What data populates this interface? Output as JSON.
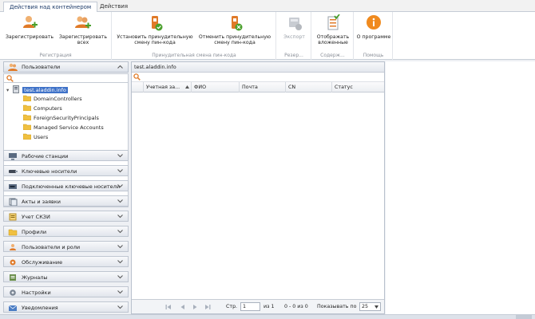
{
  "ribbon": {
    "tabs": [
      {
        "label": "Действия над контейнером",
        "active": true
      },
      {
        "label": "Действия",
        "active": false
      }
    ],
    "groups": {
      "registration": {
        "label": "Регистрация",
        "buttons": [
          {
            "label": "Зарегистрировать",
            "icon": "user-add-icon"
          },
          {
            "label": "Зарегистрировать всех",
            "icon": "users-add-icon"
          }
        ]
      },
      "pin": {
        "label": "Принудительная смена пин-кода",
        "buttons": [
          {
            "label": "Установить принудительную смену пин-кода",
            "icon": "pin-set-icon"
          },
          {
            "label": "Отменить принудительную смену пин-кода",
            "icon": "pin-cancel-icon"
          }
        ]
      },
      "backup": {
        "label": "Резер...",
        "buttons": [
          {
            "label": "Экспорт",
            "icon": "export-icon",
            "disabled": true
          }
        ]
      },
      "content": {
        "label": "Содерж...",
        "buttons": [
          {
            "label": "Отображать вложенные",
            "icon": "nested-list-icon"
          }
        ]
      },
      "help": {
        "label": "Помощь",
        "buttons": [
          {
            "label": "О программе",
            "icon": "info-icon"
          }
        ]
      }
    }
  },
  "nav": {
    "header": "Пользователи",
    "tree": {
      "root": "test.aladdin.info",
      "children": [
        "DomainControllers",
        "Computers",
        "ForeignSecurityPrincipals",
        "Managed Service Accounts",
        "Users"
      ]
    },
    "items": [
      {
        "label": "Рабочие станции",
        "icon": "workstation-icon"
      },
      {
        "label": "Ключевые носители",
        "icon": "token-icon"
      },
      {
        "label": "Подключенные ключевые носители",
        "icon": "connected-token-icon"
      },
      {
        "label": "Акты и заявки",
        "icon": "documents-icon"
      },
      {
        "label": "Учет СКЗИ",
        "icon": "accounting-icon"
      },
      {
        "label": "Профили",
        "icon": "profiles-icon"
      },
      {
        "label": "Пользователи и роли",
        "icon": "roles-icon"
      },
      {
        "label": "Обслуживание",
        "icon": "maintenance-icon"
      },
      {
        "label": "Журналы",
        "icon": "journal-icon"
      },
      {
        "label": "Настройки",
        "icon": "settings-icon"
      },
      {
        "label": "Уведомления",
        "icon": "notifications-icon"
      }
    ]
  },
  "content": {
    "title": "test.aladdin.info",
    "columns": [
      "Учетная за...",
      "ФИО",
      "Почта",
      "CN",
      "Статус"
    ],
    "pager": {
      "page_label": "Стр.",
      "page_value": "1",
      "of_pages": "из 1",
      "range": "0 - 0 из 0",
      "show_label": "Показывать по",
      "page_size": "25"
    }
  },
  "colors": {
    "selection": "#3f72c8",
    "folder": "#f0c040",
    "accent_orange": "#f08a1e",
    "accent_green": "#4aa02c"
  }
}
